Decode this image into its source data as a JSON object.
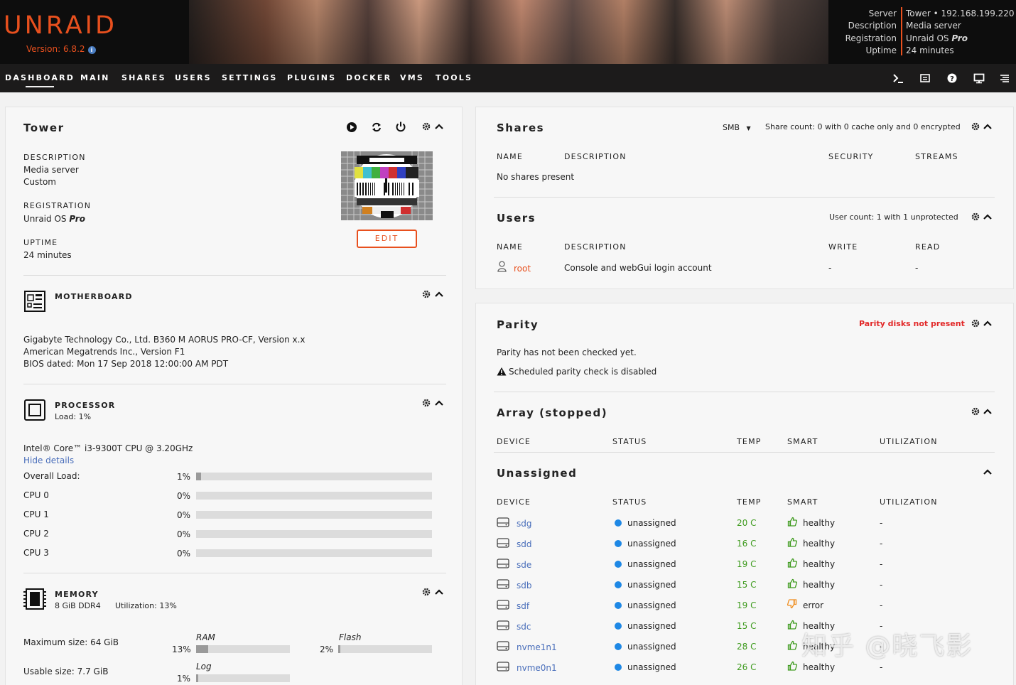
{
  "header": {
    "logo": "UNRAID",
    "version": "Version: 6.8.2",
    "server_keys": [
      "Server",
      "Description",
      "Registration",
      "Uptime"
    ],
    "server_name": "Tower",
    "server_ip": "192.168.199.220",
    "description": "Media server",
    "registration_prefix": "Unraid OS",
    "registration_tier": "Pro",
    "uptime": "24 minutes"
  },
  "nav": {
    "items": [
      "DASHBOARD",
      "MAIN",
      "SHARES",
      "USERS",
      "SETTINGS",
      "PLUGINS",
      "DOCKER",
      "VMS",
      "TOOLS"
    ],
    "active": "DASHBOARD",
    "icons": [
      "terminal-icon",
      "log-icon",
      "help-icon",
      "monitor-icon",
      "menu-icon"
    ]
  },
  "tower": {
    "title": "Tower",
    "desc_label": "DESCRIPTION",
    "desc_value": "Media server",
    "desc_sub": "Custom",
    "reg_label": "REGISTRATION",
    "reg_value": "Unraid OS",
    "reg_tier": "Pro",
    "uptime_label": "UPTIME",
    "uptime_value": "24 minutes",
    "edit": "EDIT"
  },
  "motherboard": {
    "title": "MOTHERBOARD",
    "line1": "Gigabyte Technology Co., Ltd. B360 M AORUS PRO-CF, Version x.x",
    "line2": "American Megatrends Inc., Version F1",
    "line3": "BIOS dated: Mon 17 Sep 2018 12:00:00 AM PDT"
  },
  "processor": {
    "title": "PROCESSOR",
    "load": "Load: 1%",
    "model": "Intel® Core™ i3-9300T CPU @ 3.20GHz",
    "hide": "Hide details",
    "rows": [
      {
        "name": "Overall Load:",
        "pct": "1%",
        "value": 1
      },
      {
        "name": "CPU 0",
        "pct": "0%",
        "value": 0
      },
      {
        "name": "CPU 1",
        "pct": "0%",
        "value": 0
      },
      {
        "name": "CPU 2",
        "pct": "0%",
        "value": 0
      },
      {
        "name": "CPU 3",
        "pct": "0%",
        "value": 0
      }
    ]
  },
  "memory": {
    "title": "MEMORY",
    "size": "8 GiB DDR4",
    "util": "Utilization: 13%",
    "max": "Maximum size: 64 GiB",
    "usable": "Usable size: 7.7 GiB",
    "ram_label": "RAM",
    "ram_pct": "13%",
    "ram_value": 13,
    "flash_label": "Flash",
    "flash_pct": "2%",
    "flash_value": 2,
    "log_label": "Log",
    "log_pct": "1%",
    "log_value": 1
  },
  "shares": {
    "title": "Shares",
    "protocol": "SMB",
    "summary": "Share count: 0 with 0 cache only and 0 encrypted",
    "cols": [
      "NAME",
      "DESCRIPTION",
      "SECURITY",
      "STREAMS"
    ],
    "empty": "No shares present"
  },
  "users": {
    "title": "Users",
    "summary": "User count: 1 with 1 unprotected",
    "cols": [
      "NAME",
      "DESCRIPTION",
      "WRITE",
      "READ"
    ],
    "rows": [
      {
        "name": "root",
        "desc": "Console and webGui login account",
        "write": "-",
        "read": "-"
      }
    ]
  },
  "parity": {
    "title": "Parity",
    "status": "Parity disks not present",
    "line1": "Parity has not been checked yet.",
    "line2": "Scheduled parity check is disabled"
  },
  "array": {
    "title": "Array (stopped)",
    "cols": [
      "DEVICE",
      "STATUS",
      "TEMP",
      "SMART",
      "UTILIZATION"
    ]
  },
  "unassigned": {
    "title": "Unassigned",
    "cols": [
      "DEVICE",
      "STATUS",
      "TEMP",
      "SMART",
      "UTILIZATION"
    ],
    "rows": [
      {
        "device": "sdg",
        "status": "unassigned",
        "temp": "20 C",
        "smart": "healthy",
        "util": "-",
        "ok": true
      },
      {
        "device": "sdd",
        "status": "unassigned",
        "temp": "16 C",
        "smart": "healthy",
        "util": "-",
        "ok": true
      },
      {
        "device": "sde",
        "status": "unassigned",
        "temp": "19 C",
        "smart": "healthy",
        "util": "-",
        "ok": true
      },
      {
        "device": "sdb",
        "status": "unassigned",
        "temp": "15 C",
        "smart": "healthy",
        "util": "-",
        "ok": true
      },
      {
        "device": "sdf",
        "status": "unassigned",
        "temp": "19 C",
        "smart": "error",
        "util": "-",
        "ok": false
      },
      {
        "device": "sdc",
        "status": "unassigned",
        "temp": "15 C",
        "smart": "healthy",
        "util": "-",
        "ok": true
      },
      {
        "device": "nvme1n1",
        "status": "unassigned",
        "temp": "28 C",
        "smart": "healthy",
        "util": "-",
        "ok": true
      },
      {
        "device": "nvme0n1",
        "status": "unassigned",
        "temp": "26 C",
        "smart": "healthy",
        "util": "-",
        "ok": true
      }
    ]
  },
  "watermark": "知乎 @晓飞影",
  "colors": {
    "accent": "#e8501e",
    "link": "#486dba",
    "healthy": "#3f9b1f",
    "error": "#ef8c1c",
    "alert": "#e22828",
    "status_dot": "#1e88e5"
  }
}
